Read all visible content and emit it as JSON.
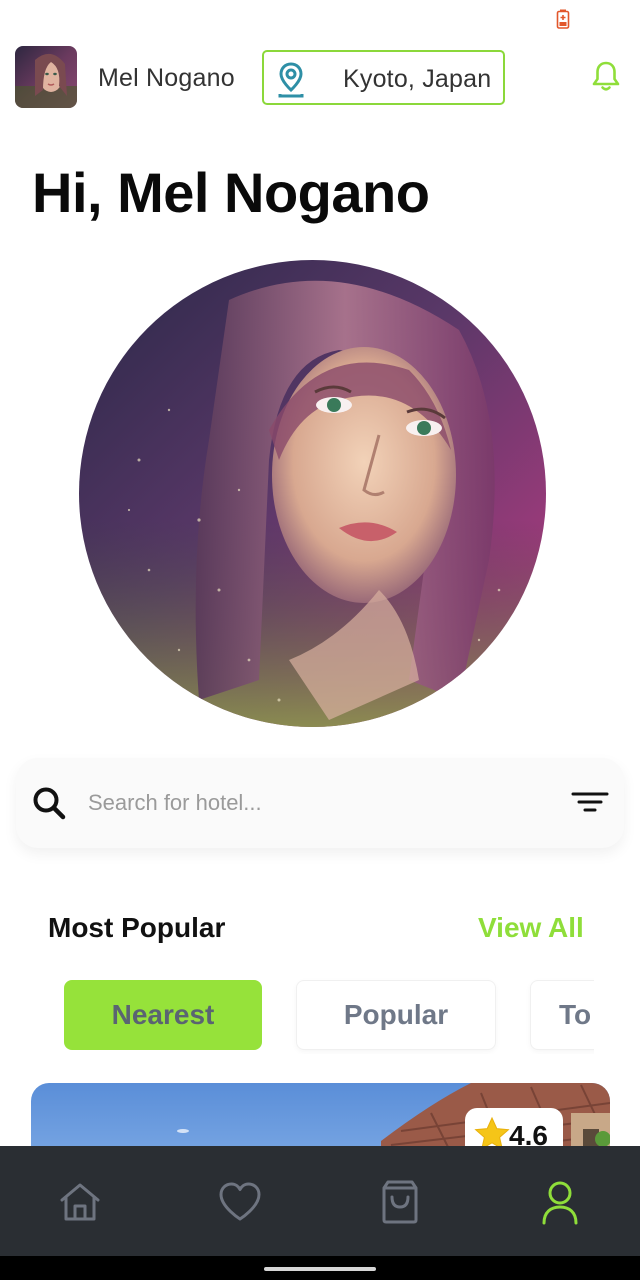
{
  "header": {
    "user_name": "Mel Nogano",
    "location": "Kyoto, Japan",
    "location_icon": "map-pin-icon",
    "notification_icon": "bell-icon"
  },
  "greeting": "Hi, Mel Nogano",
  "search": {
    "placeholder": "Search for hotel...",
    "value": "",
    "icon": "search-icon",
    "filter_icon": "filter-icon"
  },
  "popular": {
    "title": "Most Popular",
    "view_all_label": "View All",
    "chips": [
      {
        "label": "Nearest",
        "active": true
      },
      {
        "label": "Popular",
        "active": false
      },
      {
        "label": "To",
        "active": false
      }
    ]
  },
  "hotel_card": {
    "rating": "4.6",
    "rating_icon": "star-icon"
  },
  "bottom_nav": {
    "items": [
      {
        "icon": "home-icon",
        "active": false
      },
      {
        "icon": "heart-icon",
        "active": false
      },
      {
        "icon": "shopping-bag-icon",
        "active": false
      },
      {
        "icon": "profile-icon",
        "active": true
      }
    ]
  },
  "colors": {
    "accent": "#8fde3a",
    "chip_active": "#96e23a",
    "location_border": "#8bd83a",
    "pin": "#2e8fa6",
    "nav_background": "#2a2e33",
    "nav_inactive": "#6e7480",
    "battery": "#e2572b"
  }
}
